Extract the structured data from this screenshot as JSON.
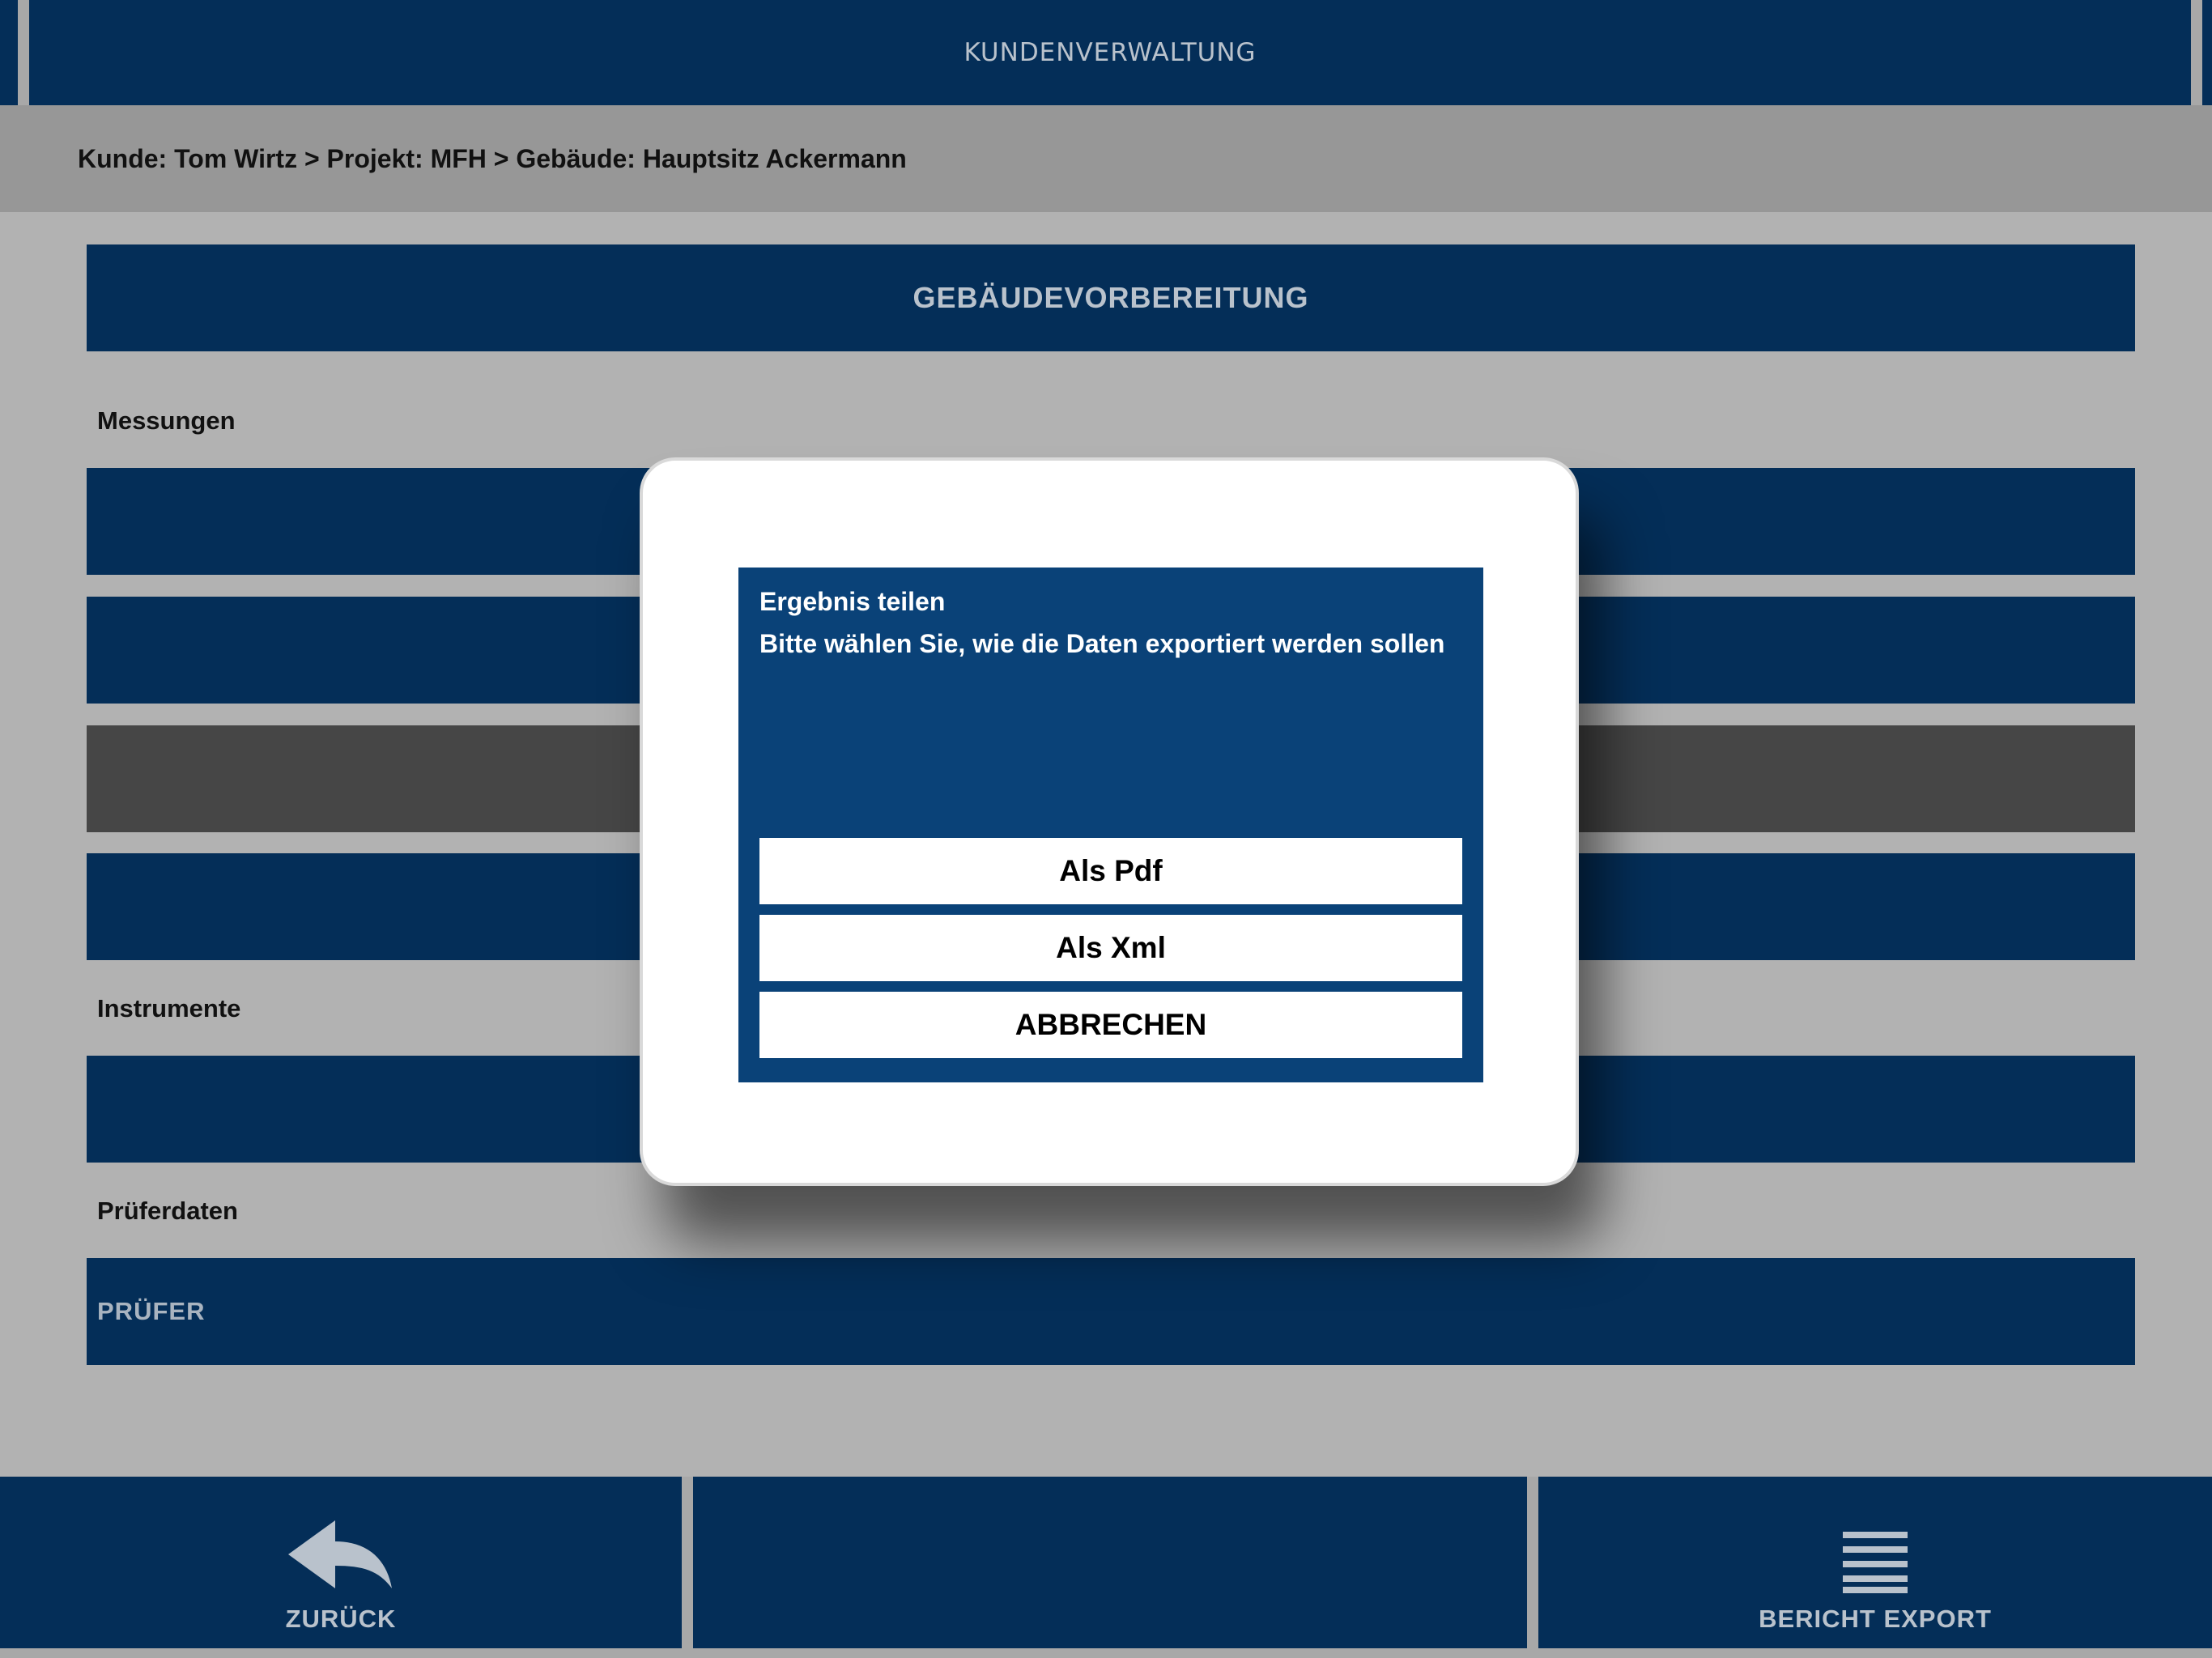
{
  "header": {
    "title": "KUNDENVERWALTUNG"
  },
  "breadcrumb": {
    "text": "Kunde: Tom Wirtz > Projekt: MFH  > Gebäude: Hauptsitz Ackermann"
  },
  "section": {
    "title": "GEBÄUDEVORBEREITUNG"
  },
  "groups": {
    "messungen": "Messungen",
    "instrumente": "Instrumente",
    "prueferdaten": "Prüferdaten"
  },
  "rows": {
    "pruefer": "PRÜFER"
  },
  "bottom_nav": {
    "back_label": "ZURÜCK",
    "back_icon": "reply-arrow-icon",
    "export_label": "BERICHT EXPORT",
    "export_icon": "menu-lines-icon"
  },
  "dialog": {
    "title": "Ergebnis teilen",
    "message": "Bitte wählen Sie, wie die Daten exportiert werden sollen",
    "buttons": [
      "Als Pdf",
      "Als Xml",
      "ABBRECHEN"
    ]
  },
  "colors": {
    "navy": "#042e58",
    "dialog_panel": "#0a4278",
    "overlay_grey": "#b2b2b2",
    "selected_row": "#464646"
  }
}
